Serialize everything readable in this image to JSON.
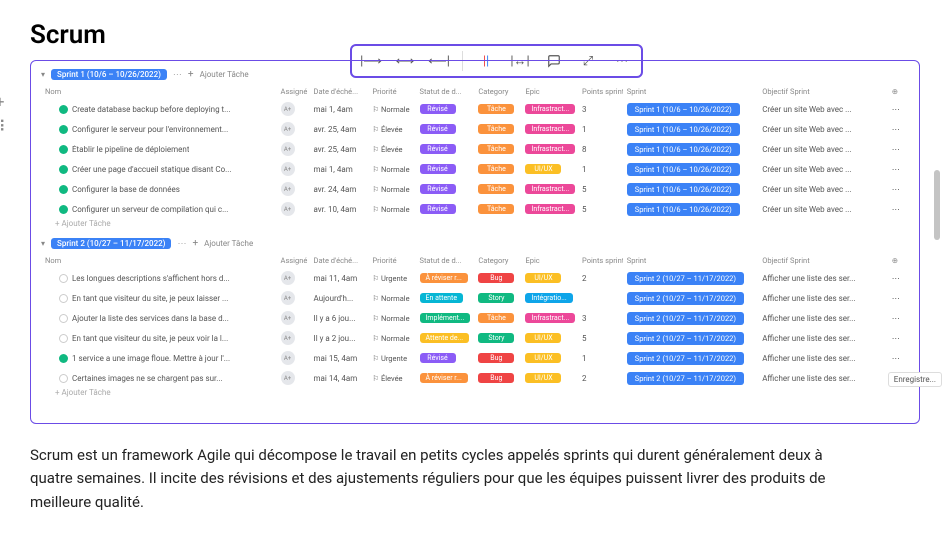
{
  "title": "Scrum",
  "toolbar": {
    "btns": [
      "align-left",
      "align-center",
      "align-right",
      "color",
      "width",
      "comment",
      "expand",
      "more"
    ]
  },
  "headers": {
    "name": "Nom",
    "assignee": "Assigné",
    "date": "Date d'éché...",
    "priority": "Priorité",
    "status": "Statut de d...",
    "category": "Category",
    "epic": "Epic",
    "points": "Points sprint",
    "sprint": "Sprint",
    "goal": "Objectif Sprint"
  },
  "group1": {
    "tag": "Sprint 1 (10/6 – 10/26/2022)",
    "addTask": "Ajouter Tâche",
    "rows": [
      {
        "done": true,
        "name": "Create database backup before deploying t...",
        "date": "mai 1, 4am",
        "pri": "Normale",
        "stat": "Révisé",
        "statC": "purple",
        "cat": "Tâche",
        "catC": "orange",
        "epic": "Infrastract...",
        "epicC": "pink",
        "pts": "3",
        "sprint": "Sprint 1 (10/6 – 10/26/2022)",
        "goal": "Créer un site Web avec ..."
      },
      {
        "done": true,
        "name": "Configurer le serveur pour l'environnement...",
        "date": "avr. 25, 4am",
        "pri": "Élevée",
        "stat": "Révisé",
        "statC": "purple",
        "cat": "Tâche",
        "catC": "orange",
        "epic": "Infrastract...",
        "epicC": "pink",
        "pts": "1",
        "sprint": "Sprint 1 (10/6 – 10/26/2022)",
        "goal": "Créer un site Web avec ..."
      },
      {
        "done": true,
        "name": "Établir le pipeline de déploiement",
        "date": "avr. 25, 4am",
        "pri": "Élevée",
        "stat": "Révisé",
        "statC": "purple",
        "cat": "Tâche",
        "catC": "orange",
        "epic": "Infrastract...",
        "epicC": "pink",
        "pts": "8",
        "sprint": "Sprint 1 (10/6 – 10/26/2022)",
        "goal": "Créer un site Web avec ..."
      },
      {
        "done": true,
        "name": "Créer une page d'accueil statique disant Co...",
        "date": "mai 1, 4am",
        "pri": "Normale",
        "stat": "Révisé",
        "statC": "purple",
        "cat": "Tâche",
        "catC": "orange",
        "epic": "UI/UX",
        "epicC": "yellow",
        "pts": "1",
        "sprint": "Sprint 1 (10/6 – 10/26/2022)",
        "goal": "Créer un site Web avec ..."
      },
      {
        "done": true,
        "name": "Configurer la base de données",
        "date": "avr. 24, 4am",
        "pri": "Normale",
        "stat": "Révisé",
        "statC": "purple",
        "cat": "Tâche",
        "catC": "orange",
        "epic": "Infrastract...",
        "epicC": "pink",
        "pts": "5",
        "sprint": "Sprint 1 (10/6 – 10/26/2022)",
        "goal": "Créer un site Web avec ..."
      },
      {
        "done": true,
        "name": "Configurer un serveur de compilation qui c...",
        "date": "avr. 10, 4am",
        "pri": "Normale",
        "stat": "Révisé",
        "statC": "purple",
        "cat": "Tâche",
        "catC": "orange",
        "epic": "Infrastract...",
        "epicC": "pink",
        "pts": "5",
        "sprint": "Sprint 1 (10/6 – 10/26/2022)",
        "goal": "Créer un site Web avec ..."
      }
    ],
    "addRow": "Ajouter Tâche"
  },
  "group2": {
    "tag": "Sprint 2 (10/27 – 11/17/2022)",
    "addTask": "Ajouter Tâche",
    "rows": [
      {
        "done": false,
        "name": "Les longues descriptions s'affichent hors d...",
        "date": "mai 11, 4am",
        "pri": "Urgente",
        "stat": "À réviser r...",
        "statC": "orange",
        "cat": "Bug",
        "catC": "red",
        "epic": "UI/UX",
        "epicC": "yellow",
        "pts": "2",
        "sprint": "Sprint 2 (10/27 – 11/17/2022)",
        "goal": "Afficher une liste des ser..."
      },
      {
        "done": false,
        "name": "En tant que visiteur du site, je peux laisser ...",
        "date": "Aujourd'h...",
        "pri": "Normale",
        "stat": "En attente",
        "statC": "cyan",
        "cat": "Story",
        "catC": "green",
        "epic": "Intégratio...",
        "epicC": "sky",
        "pts": "",
        "sprint": "Sprint 2 (10/27 – 11/17/2022)",
        "goal": "Afficher une liste des ser..."
      },
      {
        "done": false,
        "name": "Ajouter la liste des services dans la base d...",
        "date": "Il y a 6 jou...",
        "pri": "Normale",
        "stat": "Implément...",
        "statC": "green",
        "cat": "Tâche",
        "catC": "orange",
        "epic": "Infrastract...",
        "epicC": "pink",
        "pts": "3",
        "sprint": "Sprint 2 (10/27 – 11/17/2022)",
        "goal": "Afficher une liste des ser..."
      },
      {
        "done": false,
        "name": "En tant que visiteur du site, je peux voir la l...",
        "date": "Il y a 2 jou...",
        "pri": "Normale",
        "stat": "Attente de...",
        "statC": "yellow",
        "cat": "Story",
        "catC": "green",
        "epic": "UI/UX",
        "epicC": "yellow",
        "pts": "5",
        "sprint": "Sprint 2 (10/27 – 11/17/2022)",
        "goal": "Afficher une liste des ser..."
      },
      {
        "done": true,
        "name": "1 service a une image floue. Mettre à jour l'...",
        "date": "mai 15, 4am",
        "pri": "Urgente",
        "stat": "Révisé",
        "statC": "purple",
        "cat": "Bug",
        "catC": "red",
        "epic": "UI/UX",
        "epicC": "yellow",
        "pts": "1",
        "sprint": "Sprint 2 (10/27 – 11/17/2022)",
        "goal": "Afficher une liste des ser..."
      },
      {
        "done": false,
        "name": "Certaines images ne se chargent pas sur...",
        "date": "mai 14, 4am",
        "pri": "Élevée",
        "stat": "À réviser r...",
        "statC": "orange",
        "cat": "Bug",
        "catC": "red",
        "epic": "UI/UX",
        "epicC": "yellow",
        "pts": "2",
        "sprint": "Sprint 2 (10/27 – 11/17/2022)",
        "goal": "Afficher une liste des ser..."
      }
    ],
    "addRow": "Ajouter Tâche"
  },
  "saveBtn": "Enregistre...",
  "description": "Scrum est un framework Agile qui décompose le travail en petits cycles appelés sprints qui durent généralement deux à quatre semaines. Il incite des révisions et des ajustements réguliers pour que les équipes puissent livrer des produits de meilleure qualité."
}
